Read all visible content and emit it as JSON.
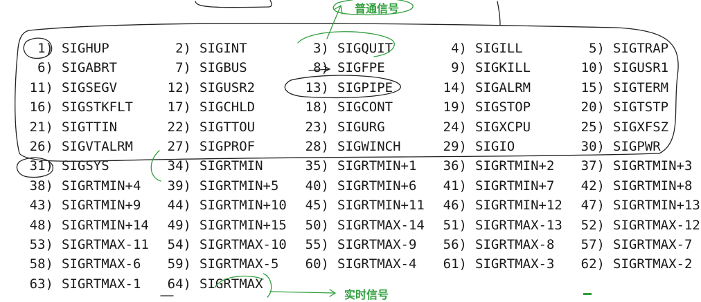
{
  "annotations": {
    "normal_signals": "普通信号",
    "realtime_signals": "实时信号"
  },
  "colors": {
    "text": "#1a1a1a",
    "black_ink": "#222222",
    "green_ink": "#2f9e3b"
  },
  "signals": [
    [
      {
        "num": "1)",
        "name": "SIGHUP"
      },
      {
        "num": "2)",
        "name": "SIGINT"
      },
      {
        "num": "3)",
        "name": "SIGQUIT"
      },
      {
        "num": "4)",
        "name": "SIGILL"
      },
      {
        "num": "5)",
        "name": "SIGTRAP"
      }
    ],
    [
      {
        "num": "6)",
        "name": "SIGABRT"
      },
      {
        "num": "7)",
        "name": "SIGBUS"
      },
      {
        "num": "8)",
        "name": "SIGFPE"
      },
      {
        "num": "9)",
        "name": "SIGKILL"
      },
      {
        "num": "10)",
        "name": "SIGUSR1"
      }
    ],
    [
      {
        "num": "11)",
        "name": "SIGSEGV"
      },
      {
        "num": "12)",
        "name": "SIGUSR2"
      },
      {
        "num": "13)",
        "name": "SIGPIPE"
      },
      {
        "num": "14)",
        "name": "SIGALRM"
      },
      {
        "num": "15)",
        "name": "SIGTERM"
      }
    ],
    [
      {
        "num": "16)",
        "name": "SIGSTKFLT"
      },
      {
        "num": "17)",
        "name": "SIGCHLD"
      },
      {
        "num": "18)",
        "name": "SIGCONT"
      },
      {
        "num": "19)",
        "name": "SIGSTOP"
      },
      {
        "num": "20)",
        "name": "SIGTSTP"
      }
    ],
    [
      {
        "num": "21)",
        "name": "SIGTTIN"
      },
      {
        "num": "22)",
        "name": "SIGTTOU"
      },
      {
        "num": "23)",
        "name": "SIGURG"
      },
      {
        "num": "24)",
        "name": "SIGXCPU"
      },
      {
        "num": "25)",
        "name": "SIGXFSZ"
      }
    ],
    [
      {
        "num": "26)",
        "name": "SIGVTALRM"
      },
      {
        "num": "27)",
        "name": "SIGPROF"
      },
      {
        "num": "28)",
        "name": "SIGWINCH"
      },
      {
        "num": "29)",
        "name": "SIGIO"
      },
      {
        "num": "30)",
        "name": "SIGPWR"
      }
    ],
    [
      {
        "num": "31)",
        "name": "SIGSYS"
      },
      {
        "num": "34)",
        "name": "SIGRTMIN"
      },
      {
        "num": "35)",
        "name": "SIGRTMIN+1"
      },
      {
        "num": "36)",
        "name": "SIGRTMIN+2"
      },
      {
        "num": "37)",
        "name": "SIGRTMIN+3"
      }
    ],
    [
      {
        "num": "38)",
        "name": "SIGRTMIN+4"
      },
      {
        "num": "39)",
        "name": "SIGRTMIN+5"
      },
      {
        "num": "40)",
        "name": "SIGRTMIN+6"
      },
      {
        "num": "41)",
        "name": "SIGRTMIN+7"
      },
      {
        "num": "42)",
        "name": "SIGRTMIN+8"
      }
    ],
    [
      {
        "num": "43)",
        "name": "SIGRTMIN+9"
      },
      {
        "num": "44)",
        "name": "SIGRTMIN+10"
      },
      {
        "num": "45)",
        "name": "SIGRTMIN+11"
      },
      {
        "num": "46)",
        "name": "SIGRTMIN+12"
      },
      {
        "num": "47)",
        "name": "SIGRTMIN+13"
      }
    ],
    [
      {
        "num": "48)",
        "name": "SIGRTMIN+14"
      },
      {
        "num": "49)",
        "name": "SIGRTMIN+15"
      },
      {
        "num": "50)",
        "name": "SIGRTMAX-14"
      },
      {
        "num": "51)",
        "name": "SIGRTMAX-13"
      },
      {
        "num": "52)",
        "name": "SIGRTMAX-12"
      }
    ],
    [
      {
        "num": "53)",
        "name": "SIGRTMAX-11"
      },
      {
        "num": "54)",
        "name": "SIGRTMAX-10"
      },
      {
        "num": "55)",
        "name": "SIGRTMAX-9"
      },
      {
        "num": "56)",
        "name": "SIGRTMAX-8"
      },
      {
        "num": "57)",
        "name": "SIGRTMAX-7"
      }
    ],
    [
      {
        "num": "58)",
        "name": "SIGRTMAX-6"
      },
      {
        "num": "59)",
        "name": "SIGRTMAX-5"
      },
      {
        "num": "60)",
        "name": "SIGRTMAX-4"
      },
      {
        "num": "61)",
        "name": "SIGRTMAX-3"
      },
      {
        "num": "62)",
        "name": "SIGRTMAX-2"
      }
    ],
    [
      {
        "num": "63)",
        "name": "SIGRTMAX-1"
      },
      {
        "num": "64)",
        "name": "SIGRTMAX"
      }
    ]
  ]
}
